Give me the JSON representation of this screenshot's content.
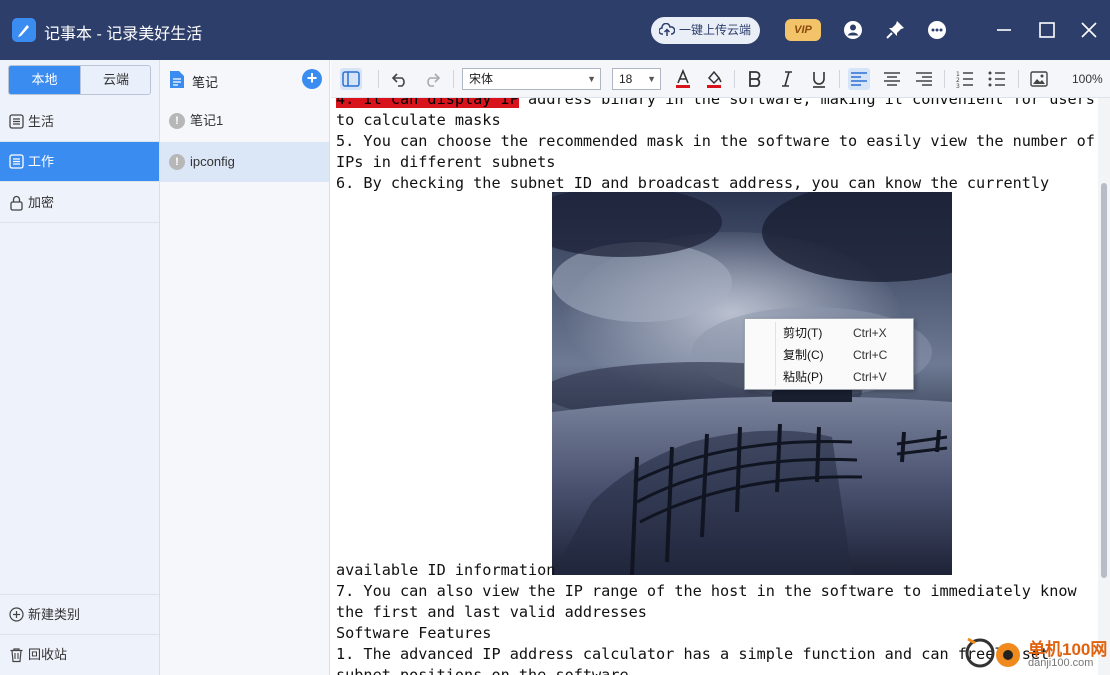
{
  "app": {
    "title": "记事本 - 记录美好生活",
    "upload_label": "一键上传云端",
    "vip_label": "VIP"
  },
  "sidebar": {
    "tabs": [
      {
        "label": "本地"
      },
      {
        "label": "云端"
      }
    ],
    "categories": [
      {
        "label": "生活",
        "icon": "list-icon"
      },
      {
        "label": "工作",
        "icon": "list-icon",
        "active": true
      },
      {
        "label": "加密",
        "icon": "lock-icon"
      }
    ],
    "new_category": "新建类别",
    "recycle_bin": "回收站"
  },
  "notes": {
    "header": "笔记",
    "items": [
      {
        "title": "笔记1"
      },
      {
        "title": "ipconfig",
        "active": true
      }
    ]
  },
  "toolbar": {
    "font": "宋体",
    "size": "18",
    "zoom": "100%",
    "colors": {
      "font_color_bar": "#d8131b",
      "accent": "#3b8cf0"
    }
  },
  "content": {
    "lines": [
      {
        "pre": "4. It can display IP",
        "post": "address binary in the software, making it convenient for users"
      },
      {
        "text": "to calculate masks"
      },
      {
        "text": "5. You can choose the recommended mask in the software to easily view the number of"
      },
      {
        "text": "IPs in different subnets"
      },
      {
        "text": "6. By checking the subnet ID and broadcast address, you can know the currently"
      },
      {
        "text": "available ID information"
      },
      {
        "text": "7. You can also view the IP range of the host in the software to immediately know"
      },
      {
        "text": "the first and last valid addresses"
      },
      {
        "text": "Software Features"
      },
      {
        "text": "1. The advanced IP address calculator has a simple function and can freely set"
      },
      {
        "text": "subnet positions on the software"
      }
    ]
  },
  "context_menu": {
    "items": [
      {
        "label": "剪切(T)",
        "shortcut": "Ctrl+X"
      },
      {
        "label": "复制(C)",
        "shortcut": "Ctrl+C"
      },
      {
        "label": "粘贴(P)",
        "shortcut": "Ctrl+V"
      }
    ]
  },
  "watermark": {
    "brand": "单机100网",
    "url": "danji100.com"
  }
}
